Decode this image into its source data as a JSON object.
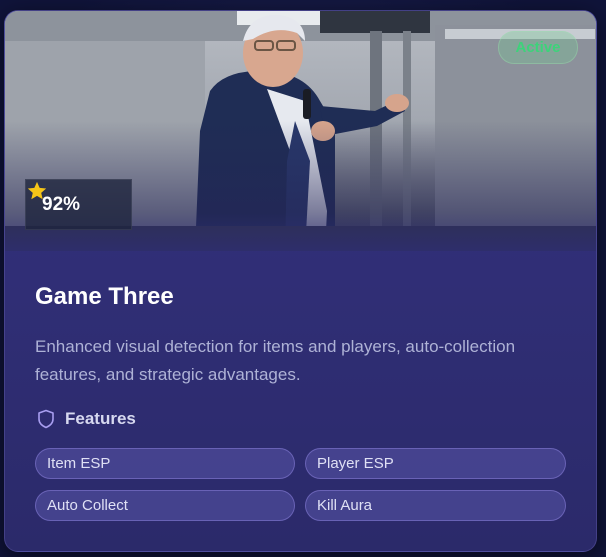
{
  "card": {
    "status": "Active",
    "rating": "92%",
    "title": "Game Three",
    "description": "Enhanced visual detection for items and players, auto-collection features, and strategic advantages.",
    "features_heading": "Features",
    "features": [
      "Item ESP",
      "Player ESP",
      "Auto Collect",
      "Kill Aura"
    ],
    "icons": {
      "rating": "star-icon",
      "features": "shield-icon"
    },
    "colors": {
      "accent": "#3dd37a",
      "star": "#f5c518",
      "card": "#312f78"
    }
  }
}
